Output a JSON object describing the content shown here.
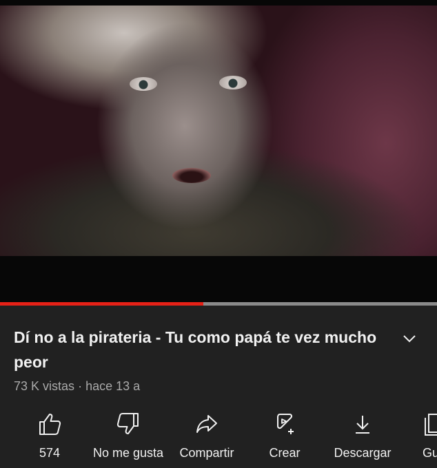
{
  "video": {
    "title": "Dí no a la pirateria - Tu como papá te vez mucho peor",
    "views": "73 K vistas",
    "separator": "·",
    "age": "hace 13 a",
    "progress_fraction": 0.465
  },
  "actions": {
    "like_count": "574",
    "dislike_label": "No me gusta",
    "share_label": "Compartir",
    "create_label": "Crear",
    "download_label": "Descargar",
    "save_label": "Gua"
  },
  "colors": {
    "background": "#212121",
    "progress": "#e62117",
    "secondary_text": "#aaaaaa"
  },
  "icons": [
    "thumbs-up-icon",
    "thumbs-down-icon",
    "share-icon",
    "create-icon",
    "download-icon",
    "save-icon",
    "chevron-down-icon"
  ]
}
